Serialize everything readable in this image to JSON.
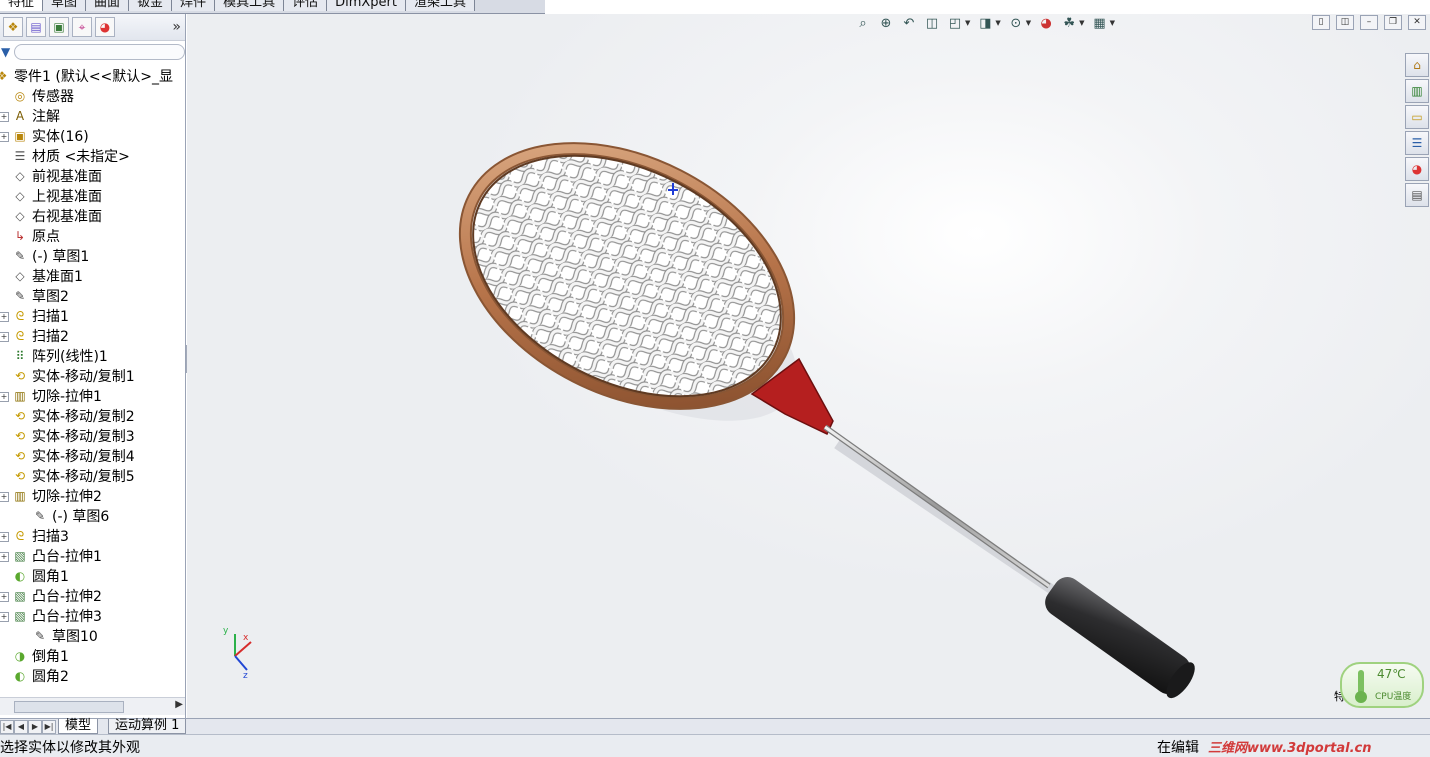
{
  "top_tabs": [
    "特征",
    "草图",
    "曲面",
    "钣金",
    "焊件",
    "模具工具",
    "评估",
    "DimXpert",
    "渲染工具"
  ],
  "feature_tree": [
    {
      "label": "零件1 (默认<<默认>_显",
      "icon": "part-icon",
      "indent": 0,
      "expander": false
    },
    {
      "label": "传感器",
      "icon": "sensor-icon",
      "indent": 1,
      "expander": false
    },
    {
      "label": "注解",
      "icon": "annotation-icon",
      "indent": 1,
      "expander": true
    },
    {
      "label": "实体(16)",
      "icon": "solid-bodies-icon",
      "indent": 1,
      "expander": true
    },
    {
      "label": "材质 <未指定>",
      "icon": "material-icon",
      "indent": 1,
      "expander": false
    },
    {
      "label": "前视基准面",
      "icon": "plane-icon",
      "indent": 1,
      "expander": false
    },
    {
      "label": "上视基准面",
      "icon": "plane-icon",
      "indent": 1,
      "expander": false
    },
    {
      "label": "右视基准面",
      "icon": "plane-icon",
      "indent": 1,
      "expander": false
    },
    {
      "label": "原点",
      "icon": "origin-icon",
      "indent": 1,
      "expander": false
    },
    {
      "label": "(-) 草图1",
      "icon": "sketch-icon",
      "indent": 1,
      "expander": false
    },
    {
      "label": "基准面1",
      "icon": "plane-icon",
      "indent": 1,
      "expander": false
    },
    {
      "label": "草图2",
      "icon": "sketch-icon",
      "indent": 1,
      "expander": false
    },
    {
      "label": "扫描1",
      "icon": "sweep-icon",
      "indent": 1,
      "expander": true
    },
    {
      "label": "扫描2",
      "icon": "sweep-icon",
      "indent": 1,
      "expander": true
    },
    {
      "label": "阵列(线性)1",
      "icon": "linear-pattern-icon",
      "indent": 1,
      "expander": false
    },
    {
      "label": "实体-移动/复制1",
      "icon": "move-copy-icon",
      "indent": 1,
      "expander": false
    },
    {
      "label": "切除-拉伸1",
      "icon": "cut-extrude-icon",
      "indent": 1,
      "expander": true
    },
    {
      "label": "实体-移动/复制2",
      "icon": "move-copy-icon",
      "indent": 1,
      "expander": false
    },
    {
      "label": "实体-移动/复制3",
      "icon": "move-copy-icon",
      "indent": 1,
      "expander": false
    },
    {
      "label": "实体-移动/复制4",
      "icon": "move-copy-icon",
      "indent": 1,
      "expander": false
    },
    {
      "label": "实体-移动/复制5",
      "icon": "move-copy-icon",
      "indent": 1,
      "expander": false
    },
    {
      "label": "切除-拉伸2",
      "icon": "cut-extrude-icon",
      "indent": 1,
      "expander": true
    },
    {
      "label": "(-) 草图6",
      "icon": "sketch-icon",
      "indent": 2,
      "expander": false
    },
    {
      "label": "扫描3",
      "icon": "sweep-icon",
      "indent": 1,
      "expander": true
    },
    {
      "label": "凸台-拉伸1",
      "icon": "boss-extrude-icon",
      "indent": 1,
      "expander": true
    },
    {
      "label": "圆角1",
      "icon": "fillet-icon",
      "indent": 1,
      "expander": false
    },
    {
      "label": "凸台-拉伸2",
      "icon": "boss-extrude-icon",
      "indent": 1,
      "expander": true
    },
    {
      "label": "凸台-拉伸3",
      "icon": "boss-extrude-icon",
      "indent": 1,
      "expander": true
    },
    {
      "label": "草图10",
      "icon": "sketch-icon",
      "indent": 2,
      "expander": false
    },
    {
      "label": "倒角1",
      "icon": "chamfer-icon",
      "indent": 1,
      "expander": false
    },
    {
      "label": "圆角2",
      "icon": "fillet-icon",
      "indent": 1,
      "expander": false
    }
  ],
  "bottom_tabs": {
    "model": "模型",
    "motion_study": "运动算例 1"
  },
  "status": {
    "message": "选择实体以修改其外观",
    "mode": "在编辑",
    "watermark": "三维网www.3dportal.cn"
  },
  "cpu_widget": {
    "temperature": "47℃",
    "label": "CPU温度"
  },
  "triad": {
    "x": "x",
    "y": "y",
    "z": "z"
  },
  "misc": {
    "partial_char": "特"
  },
  "colors": {
    "frame": "#b7744a",
    "throat": "#b51f1f",
    "handle": "#2d2d2f",
    "mesh": "#e8e8e8",
    "accent": "#2a5fa8"
  }
}
